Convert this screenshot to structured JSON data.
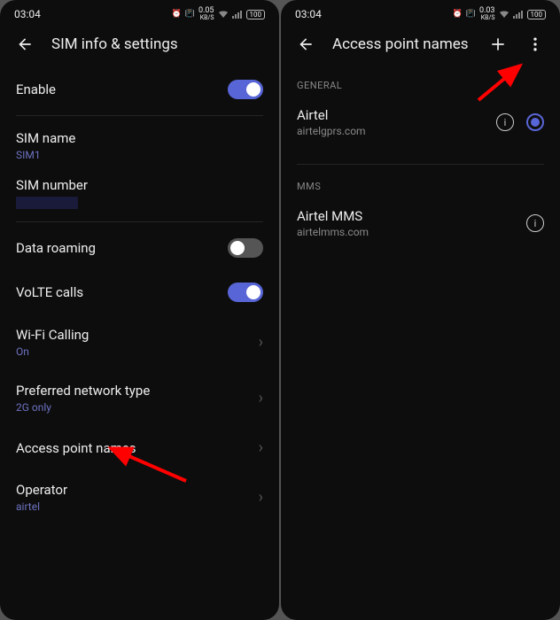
{
  "left": {
    "status": {
      "time": "03:04",
      "net": "0.05",
      "netUnit": "KB/S",
      "batt": "100"
    },
    "title": "SIM info & settings",
    "enable": {
      "label": "Enable",
      "on": true
    },
    "simName": {
      "label": "SIM name",
      "value": "SIM1"
    },
    "simNumber": {
      "label": "SIM number"
    },
    "roaming": {
      "label": "Data roaming",
      "on": false
    },
    "volte": {
      "label": "VoLTE calls",
      "on": true
    },
    "wifiCalling": {
      "label": "Wi-Fi Calling",
      "value": "On"
    },
    "prefNet": {
      "label": "Preferred network type",
      "value": "2G only"
    },
    "apn": {
      "label": "Access point names"
    },
    "operator": {
      "label": "Operator",
      "value": "airtel"
    }
  },
  "right": {
    "status": {
      "time": "03:04",
      "net": "0.03",
      "netUnit": "KB/S",
      "batt": "100"
    },
    "title": "Access point names",
    "sections": {
      "general": {
        "label": "GENERAL",
        "item": {
          "name": "Airtel",
          "host": "airtelgprs.com",
          "selected": true
        }
      },
      "mms": {
        "label": "MMS",
        "item": {
          "name": "Airtel MMS",
          "host": "airtelmms.com"
        }
      }
    }
  }
}
